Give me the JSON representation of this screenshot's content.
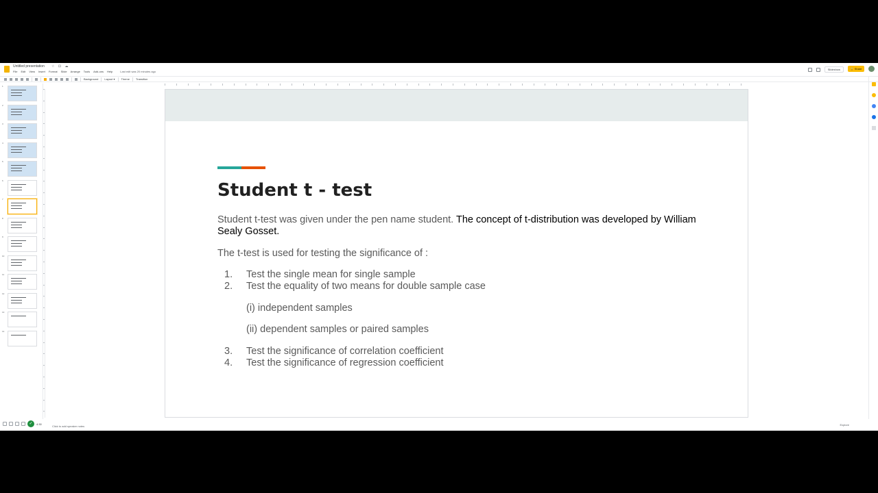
{
  "app": {
    "doc_title": "Untitled presentation",
    "title_icons": "☆ ⊡ ☁",
    "menu": [
      "File",
      "Edit",
      "View",
      "Insert",
      "Format",
      "Slide",
      "Arrange",
      "Tools",
      "Add-ons",
      "Help"
    ],
    "last_edit": "Last edit was 20 minutes ago",
    "slideshow_label": "Slideshow",
    "share_label": "🔒 Share"
  },
  "toolbar": {
    "background_label": "Background",
    "layout_label": "Layout ▾",
    "theme_label": "Theme",
    "transition_label": "Transition"
  },
  "filmstrip": {
    "slide_numbers": [
      "1",
      "2",
      "3",
      "4",
      "5",
      "6",
      "7",
      "8",
      "9",
      "10",
      "11",
      "12",
      "13",
      "14"
    ],
    "active_index": 6
  },
  "slide": {
    "title": "Student t - test",
    "para1_gray": "Student t-test was given under the pen name student.",
    "para1_dark": " The concept of t-distribution was developed by William Sealy Gosset.",
    "para2": "The t-test is used for testing the significance of :",
    "list": [
      {
        "num": "1.",
        "text": "Test the single mean for single sample"
      },
      {
        "num": "2.",
        "text": "Test the equality of two means for double sample case"
      },
      {
        "num": "",
        "text": "(i) independent samples"
      },
      {
        "num": "",
        "text": "(ii) dependent samples or paired samples"
      },
      {
        "num": "3.",
        "text": "Test the significance of correlation coefficient"
      },
      {
        "num": "4.",
        "text": "Test the significance of regression coefficient"
      }
    ],
    "colors": {
      "band": "#e6ecec",
      "accent_green": "#26a69a",
      "accent_orange": "#e65100"
    }
  },
  "notes": {
    "placeholder": "Click to add speaker notes",
    "explore_label": "Explore"
  },
  "status": {
    "zoom": "4:30"
  }
}
